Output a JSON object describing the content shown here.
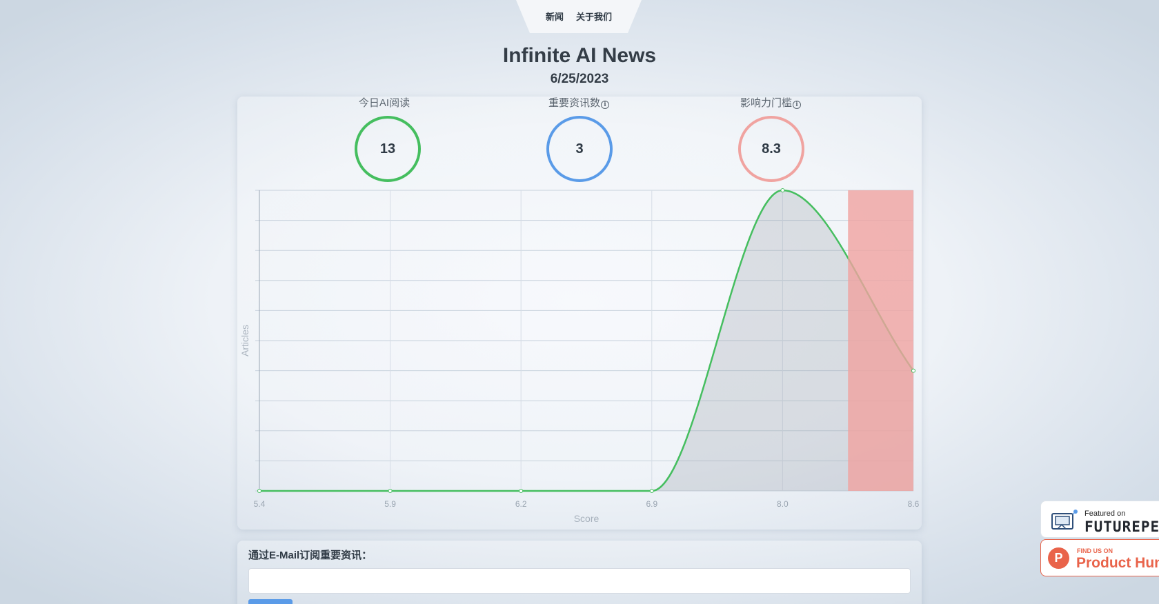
{
  "nav": {
    "items": [
      {
        "label": "新闻"
      },
      {
        "label": "关于我们"
      }
    ],
    "active_color": "#e8514a"
  },
  "header": {
    "title": "Infinite AI News",
    "date": "6/25/2023"
  },
  "stats": [
    {
      "label": "今日AI阅读",
      "value": "13",
      "color": "#45be5f",
      "has_info": false
    },
    {
      "label": "重要资讯数",
      "value": "3",
      "color": "#5a9be8",
      "has_info": true
    },
    {
      "label": "影响力门槛",
      "value": "8.3",
      "color": "#f0a3a0",
      "has_info": true
    }
  ],
  "info_glyph": "i",
  "chart_data": {
    "type": "area",
    "x": [
      5.4,
      5.9,
      6.2,
      6.9,
      8.0,
      8.6
    ],
    "x_tick_labels": [
      "5.4",
      "5.9",
      "6.2",
      "6.9",
      "8.0",
      "8.6"
    ],
    "series": [
      {
        "values": [
          0,
          0,
          0,
          0,
          10,
          4
        ],
        "color": "#45be5f"
      }
    ],
    "xlabel": "Score",
    "ylabel": "Articles",
    "ylim": [
      0,
      10
    ],
    "grid": true,
    "threshold_band": {
      "from_x": 8.3,
      "color": "#f0a3a0"
    }
  },
  "subscribe": {
    "label": "通过E-Mail订阅重要资讯：",
    "input_value": "",
    "button_color": "#5a9be8"
  },
  "badges": {
    "futurepedia": {
      "small": "Featured on",
      "big": "FUTUREPEDIA"
    },
    "producthunt": {
      "letter": "P",
      "small": "FIND US ON",
      "big": "Product Hunt"
    }
  }
}
